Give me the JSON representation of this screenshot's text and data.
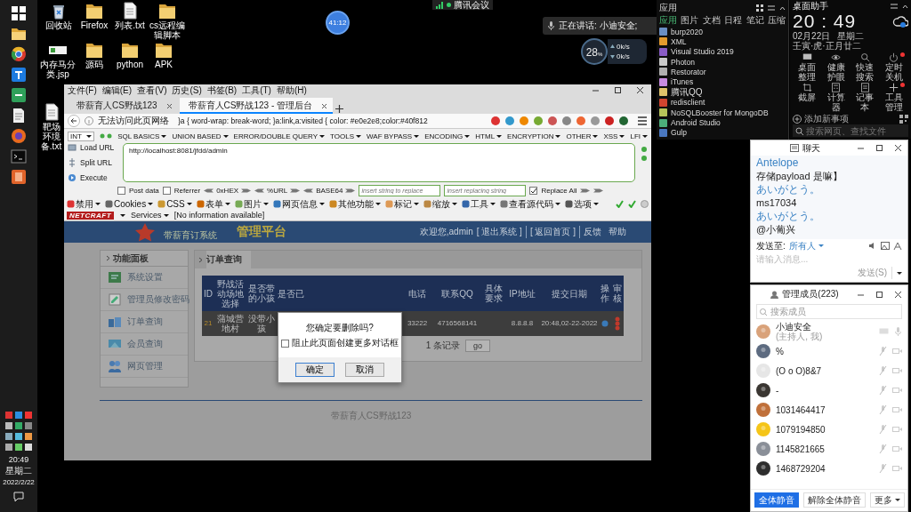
{
  "taskbar": {
    "time": "20:49",
    "weekday": "星期二",
    "date": "2022/2/22"
  },
  "desktop_icons": [
    {
      "label": "回收站",
      "kind": "bin"
    },
    {
      "label": "Firefox",
      "kind": "folder"
    },
    {
      "label": "列表.txt",
      "kind": "file"
    },
    {
      "label": "cs远程编辑脚本",
      "kind": "folder"
    },
    {
      "label": "内存马分类.jsp",
      "kind": "banner"
    },
    {
      "label": "源码",
      "kind": "folder"
    },
    {
      "label": "python",
      "kind": "folder"
    },
    {
      "label": "APK",
      "kind": "folder"
    },
    {
      "label": "靶场环境备.txt",
      "kind": "file"
    }
  ],
  "meeting": {
    "app": "腾讯会议",
    "timer": "41:12",
    "speaking": "正在讲话: 小迪安全;",
    "cpu": "28",
    "cpu_unit": "%",
    "upload": "0k/s",
    "download": "0k/s"
  },
  "browser": {
    "menu": [
      "文件(F)",
      "编辑(E)",
      "查看(V)",
      "历史(S)",
      "书签(B)",
      "工具(T)",
      "帮助(H)"
    ],
    "tabs": [
      {
        "label": "带薪育人CS野战123",
        "selected": false
      },
      {
        "label": "带薪育人CS野战123 - 管理后台",
        "selected": true
      }
    ],
    "address_notice": "无法访问此页网络",
    "address_text": "}a { word-wrap: break-word; }a:link,a:visited { color: #e0e2e8;color:#40f812",
    "hackbar": {
      "select": "INT",
      "menus": [
        "SQL BASICS",
        "UNION BASED",
        "ERROR/DOUBLE QUERY",
        "TOOLS",
        "WAF BYPASS",
        "ENCODING",
        "HTML",
        "ENCRYPTION",
        "OTHER",
        "XSS",
        "LFI"
      ],
      "actions": [
        "Load URL",
        "Split URL",
        "Execute"
      ],
      "url": "http://localhost:8081/jfdd/admin",
      "options": [
        {
          "kind": "checkbox",
          "label": "Post data",
          "checked": false
        },
        {
          "kind": "checkbox",
          "label": "Referrer",
          "checked": false
        },
        {
          "kind": "encoder",
          "label": "0xHEX"
        },
        {
          "kind": "encoder",
          "label": "%URL"
        },
        {
          "kind": "encoder",
          "label": "BASE64"
        },
        {
          "kind": "field",
          "placeholder": "insert string to replace"
        },
        {
          "kind": "field",
          "placeholder": "insert replacing string"
        },
        {
          "kind": "checkbox",
          "label": "Replace All",
          "checked": true
        }
      ]
    },
    "devbar": [
      "禁用",
      "Cookies",
      "CSS",
      "表单",
      "图片",
      "网页信息",
      "其他功能",
      "标记",
      "缩放",
      "工具",
      "查看源代码",
      "选项"
    ],
    "netcraft": {
      "logo": "NETCRAFT",
      "services": "Services",
      "info": "[No information available]"
    }
  },
  "page": {
    "logo_caption": "带薪育订系统",
    "title": "管理平台",
    "welcome": "欢迎您,admin",
    "links": [
      "[ 退出系统 ]",
      "[ 返回首页 ]",
      "反馈",
      "帮助"
    ],
    "sidebar": {
      "title": "功能面板",
      "items": [
        "系统设置",
        "管理员修改密码",
        "订单查询",
        "会员查询",
        "网页管理"
      ]
    },
    "tab": "订单查询",
    "columns": [
      {
        "label": "ID",
        "cell": "21"
      },
      {
        "label": "野战活动场地选择",
        "cell": "蒲城营地村"
      },
      {
        "label": "是否带的小孩",
        "cell": "没带小孩"
      },
      {
        "label": "是否已"
      },
      {
        "label": "电话",
        "cell": "33222"
      },
      {
        "label": "联系QQ",
        "cell": "4716568141"
      },
      {
        "label": "具体要求"
      },
      {
        "label": "IP地址",
        "cell": "8.8.8.8"
      },
      {
        "label": "提交日期",
        "cell": "20:48,02-22-2022"
      },
      {
        "label": "操作",
        "kind": "action"
      },
      {
        "label": "审核",
        "kind": "review"
      }
    ],
    "records": "1 条记录",
    "go": "go",
    "footer": "带薪育人CS野战123",
    "dialog": {
      "message": "您确定要删除吗?",
      "option": "阻止此页面创建更多对话框",
      "checked": false,
      "buttons": [
        "确定",
        "取消"
      ]
    }
  },
  "app_panel": {
    "title": "应用",
    "tabs": [
      {
        "label": "应用",
        "selected": true
      },
      {
        "label": "图片",
        "selected": false
      },
      {
        "label": "文档",
        "selected": false
      },
      {
        "label": "日程",
        "selected": false
      },
      {
        "label": "笔记",
        "selected": false
      },
      {
        "label": "压缩",
        "selected": false
      }
    ],
    "items": [
      {
        "label": "burp2020",
        "color": "#6a8fc4"
      },
      {
        "label": "XML",
        "color": "#e39a2d"
      },
      {
        "label": "Visual Studio 2019",
        "color": "#8a5cc6"
      },
      {
        "label": "Photon",
        "color": "#c9c9c9"
      },
      {
        "label": "Restorator",
        "color": "#b0b0b0"
      },
      {
        "label": "iTunes",
        "color": "#c78be0"
      },
      {
        "label": "腾讯QQ",
        "color": "#e0c36a"
      },
      {
        "label": "redisclient",
        "color": "#d2452f"
      },
      {
        "label": "NoSQLBooster for MongoDB",
        "color": "#b7c45a"
      },
      {
        "label": "Android Studio",
        "color": "#4caf7a"
      },
      {
        "label": "Gulp",
        "color": "#4a78c0"
      }
    ]
  },
  "clock": {
    "title": "桌面助手",
    "time": "20 : 49",
    "date": "02月22日",
    "weekday": "星期二",
    "lunar": "壬寅·虎·正月廿二",
    "tools": [
      {
        "label": "桌面整理",
        "kind": "monitor",
        "badge": false
      },
      {
        "label": "健康护眼",
        "kind": "eye",
        "badge": false
      },
      {
        "label": "快速搜索",
        "kind": "search",
        "badge": false
      },
      {
        "label": "定时关机",
        "kind": "power",
        "badge": true
      },
      {
        "label": "截屏",
        "kind": "crop",
        "badge": false
      },
      {
        "label": "计算器",
        "kind": "calc",
        "badge": false
      },
      {
        "label": "记事本",
        "kind": "note",
        "badge": false
      },
      {
        "label": "工具管理",
        "kind": "plus",
        "badge": true
      }
    ],
    "add_task": "添加新事项",
    "search_placeholder": "搜索网页、查找文件"
  },
  "chat": {
    "title": "聊天",
    "messages": [
      {
        "text": "Antelope",
        "kind": "sender"
      },
      {
        "text": "存储payload 是嘛】",
        "kind": "message"
      },
      {
        "text": "あいがとう。",
        "kind": "sender"
      },
      {
        "text": "ms17034",
        "kind": "message"
      },
      {
        "text": "あいがとう。",
        "kind": "sender"
      },
      {
        "text": "@小葡兴",
        "kind": "message"
      }
    ],
    "send_to_label": "发送至:",
    "recipient": "所有人",
    "placeholder": "请输入消息...",
    "send": "发送(S)"
  },
  "members": {
    "title": "管理成员(223)",
    "search_placeholder": "搜索成员",
    "list": [
      {
        "name": "小迪安全",
        "role": "(主持人, 我)",
        "color": "#d9a27a",
        "muted": false
      },
      {
        "name": "%",
        "color": "#5d6b80",
        "muted": true
      },
      {
        "name": "(O o O)8&7",
        "color": "#e6e6e6",
        "muted": true
      },
      {
        "name": "-",
        "color": "#3a3632",
        "muted": true
      },
      {
        "name": "1031464417",
        "color": "#c0703a",
        "muted": true
      },
      {
        "name": "1079194850",
        "color": "#f5c518",
        "muted": true
      },
      {
        "name": "1145821665",
        "color": "#8a8f98",
        "muted": true
      },
      {
        "name": "1468729204",
        "color": "#2e2e2e",
        "muted": true
      }
    ],
    "buttons": [
      {
        "label": "全体静音",
        "primary": true
      },
      {
        "label": "解除全体静音",
        "primary": false
      },
      {
        "label": "更多",
        "primary": false
      }
    ]
  }
}
